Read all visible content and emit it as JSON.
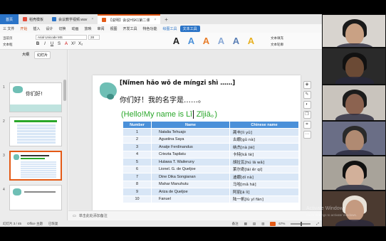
{
  "app": {
    "tabs": [
      {
        "label": "首页",
        "kind": "home"
      },
      {
        "label": "稻壳模板",
        "kind": "normal",
        "color": "#e24b3a"
      },
      {
        "label": "会议教学视频.wav",
        "kind": "normal",
        "color": "#2b74c7"
      },
      {
        "label": "【说明】会议HSK1第二课",
        "kind": "active",
        "color": "#e45a16"
      }
    ],
    "menu": [
      "三 文件",
      "开始",
      "插入",
      "设计",
      "切换",
      "动画",
      "放映",
      "审阅",
      "视图",
      "开发工具",
      "特色功能"
    ],
    "menu_selected": "开始",
    "menu_tools": [
      "绘图工具",
      "文本工具"
    ]
  },
  "ribbon": {
    "font_name": "Arial Unicode MS",
    "font_size": "28",
    "left_buttons": [
      "当前页",
      "文本框",
      "排列"
    ],
    "format_buttons": [
      "B",
      "I",
      "U",
      "S",
      "A",
      "X²",
      "X₂",
      "A"
    ],
    "right_tools": [
      "文本填充",
      "文本轮廓",
      "文本效果"
    ],
    "style_colors": [
      "#222222",
      "#4a90d9",
      "#e87d2a",
      "#8aa9d6",
      "#5a7fb5",
      "#e8b020"
    ]
  },
  "panel": {
    "tabs": [
      "大纲",
      "幻灯片"
    ],
    "selected_tab": "幻灯片",
    "thumbnails": [
      {
        "num": "1",
        "title": "你们好!"
      },
      {
        "num": "2",
        "title": ""
      },
      {
        "num": "3",
        "title": ""
      },
      {
        "num": "4",
        "title": ""
      }
    ]
  },
  "slide": {
    "pinyin": "[Nǐmen hǎo wǒ de míngzi  shì ……]",
    "hanzi": "你们好！我的名字是……。",
    "hello_prefix": "(Hello!My name is Lǐ",
    "hello_suffix": " Zǐjiā。)",
    "table": {
      "headers": [
        "Number",
        "Name",
        "Chinese name"
      ],
      "rows": [
        [
          "1",
          "Natalia Tehuajo",
          "蔺丰[lì yǔ]"
        ],
        [
          "2",
          "Agustina Saya",
          "古娜[gǔ nà]"
        ],
        [
          "3",
          "Anatje Ferdinandus",
          "纳杰[nà jié]"
        ],
        [
          "4",
          "Criezta Tapilatu",
          "卡特[kǎ tè]"
        ],
        [
          "5",
          "Hulawa T. Waileruny",
          "胡拉瓦[hú lā wǎ]"
        ],
        [
          "6",
          "Lionel. G. de Queljoe",
          "莱尔奇[lái ěr qí]"
        ],
        [
          "7",
          "Dine Dika Songianan",
          "迪娜[dí nà]"
        ],
        [
          "8",
          "Mahar Manuhutu",
          "马哈[mǎ hā]"
        ],
        [
          "9",
          "Ariza de Queljoe",
          "阿丽[ā lì]"
        ],
        [
          "10",
          "Fanuel",
          "陆一帆[lù yī fān]"
        ]
      ]
    }
  },
  "notes": {
    "placeholder": "单击此处添加备注"
  },
  "status": {
    "slide_info": "幻灯片 3 / 45",
    "theme": "Office 主题",
    "autosave": "已恢复",
    "notes_toggle": "备注",
    "zoom": "67%",
    "watermark_title": "Activate Windows",
    "watermark_sub": "Go to Settings to activate Windows."
  },
  "video": {
    "tiles": [
      {
        "bg": "#d8d4cf",
        "skin": "#c9a184",
        "hair": "#1a1a1a"
      },
      {
        "bg": "#2a2a2a",
        "skin": "#6b4a35",
        "hair": "#111111"
      },
      {
        "bg": "#c9c4bd",
        "skin": "#8c6350",
        "hair": "#1c1c1c"
      },
      {
        "bg": "#6a6e86",
        "skin": "#b08a72",
        "hair": "#2a2a2a"
      },
      {
        "bg": "#a8a39a",
        "skin": "#d2b09a",
        "hair": "#111111"
      },
      {
        "bg": "#4b3a30",
        "skin": "#c49a80",
        "hair": "#e8e2d8"
      }
    ]
  }
}
